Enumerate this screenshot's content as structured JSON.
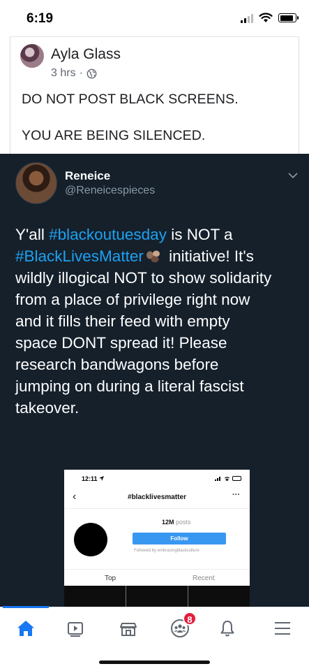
{
  "status_bar": {
    "time": "6:19"
  },
  "post": {
    "author": "Ayla Glass",
    "time": "3 hrs",
    "separator": "·",
    "lines": [
      "DO NOT POST BLACK SCREENS.",
      "",
      "YOU ARE BEING SILENCED."
    ]
  },
  "tweet": {
    "name": "Reneice",
    "handle": "@Reneicespieces",
    "line1_a": "Y'all ",
    "line1_tag": "#blackoutuesday",
    "line1_b": " is NOT a",
    "line2_tag": "#BlackLivesMatter",
    "line2_b": " initiative! It's",
    "line3": "wildly illogical NOT to show solidarity",
    "line4": "from a place of privilege right now",
    "line5": "and it fills their feed with empty",
    "line6": "space DONT spread it! Please",
    "line7": "research bandwagons before",
    "line8": "jumping on during a literal fascist",
    "line9": "takeover."
  },
  "embed": {
    "time": "12:11",
    "title": "#blacklivesmatter",
    "more": "···",
    "back": "‹",
    "posts_count": "12M",
    "posts_label": "posts",
    "follow_label": "Follow",
    "followed_by": "Followed by embracingblackculture",
    "tab_top": "Top",
    "tab_recent": "Recent"
  },
  "nav": {
    "badge_count": "8",
    "accent": "#1877f2",
    "items": [
      "home-icon",
      "watch-icon",
      "marketplace-icon",
      "groups-icon",
      "notifications-icon",
      "menu-icon"
    ]
  },
  "colors": {
    "tweet_bg": "#15202b",
    "hashtag": "#1da1f2",
    "badge": "#e41e3f"
  }
}
